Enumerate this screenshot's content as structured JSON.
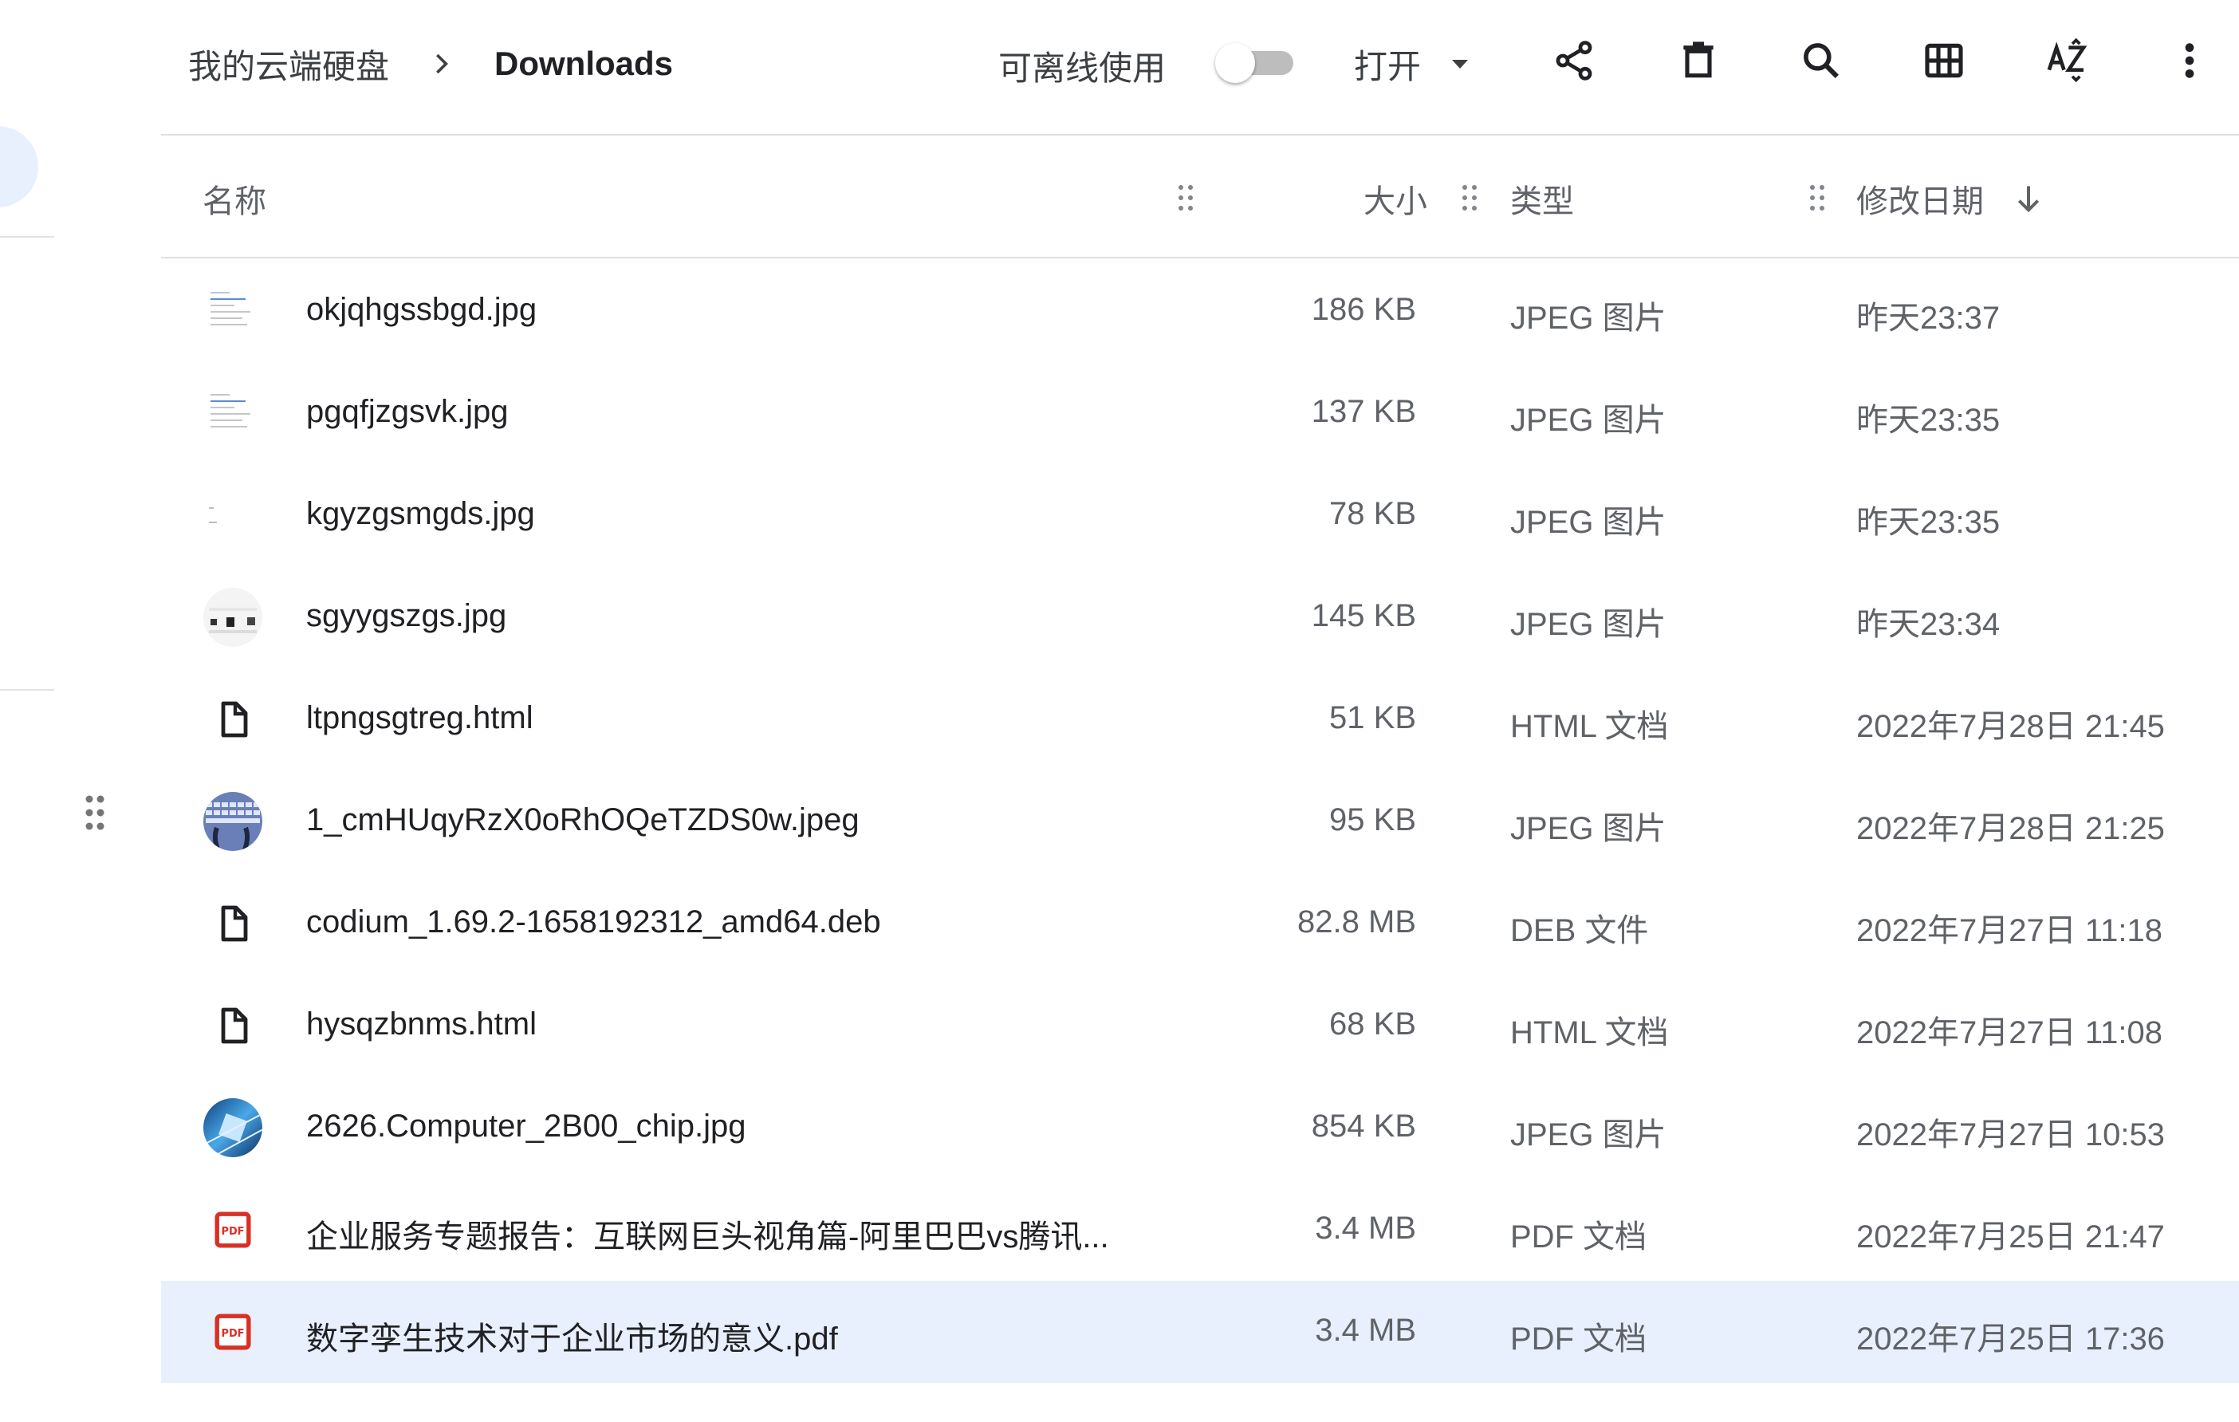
{
  "breadcrumb": {
    "root": "我的云端硬盘",
    "current": "Downloads"
  },
  "toolbar": {
    "offline_label": "可离线使用",
    "offline_enabled": false,
    "open_label": "打开",
    "icons": [
      "share-icon",
      "delete-icon",
      "search-icon",
      "grid-view-icon",
      "sort-az-icon",
      "more-vert-icon"
    ]
  },
  "columns": {
    "name": "名称",
    "size": "大小",
    "type": "类型",
    "modified": "修改日期"
  },
  "files": [
    {
      "name": "okjqhgssbgd.jpg",
      "size": "186 KB",
      "type": "JPEG 图片",
      "modified": "昨天23:37",
      "icon": "thumb-doc"
    },
    {
      "name": "pgqfjzgsvk.jpg",
      "size": "137 KB",
      "type": "JPEG 图片",
      "modified": "昨天23:35",
      "icon": "thumb-doc"
    },
    {
      "name": "kgyzgsmgds.jpg",
      "size": "78 KB",
      "type": "JPEG 图片",
      "modified": "昨天23:35",
      "icon": "thumb-blank"
    },
    {
      "name": "sgyygszgs.jpg",
      "size": "145 KB",
      "type": "JPEG 图片",
      "modified": "昨天23:34",
      "icon": "thumb-ui"
    },
    {
      "name": "ltpngsgtreg.html",
      "size": "51 KB",
      "type": "HTML 文档",
      "modified": "2022年7月28日 21:45",
      "icon": "file-icon"
    },
    {
      "name": "1_cmHUqyRzX0oRhOQeTZDS0w.jpeg",
      "size": "95 KB",
      "type": "JPEG 图片",
      "modified": "2022年7月28日 21:25",
      "icon": "thumb-keyboard"
    },
    {
      "name": "codium_1.69.2-1658192312_amd64.deb",
      "size": "82.8 MB",
      "type": "DEB 文件",
      "modified": "2022年7月27日 11:18",
      "icon": "file-icon"
    },
    {
      "name": "hysqzbnms.html",
      "size": "68 KB",
      "type": "HTML 文档",
      "modified": "2022年7月27日 11:08",
      "icon": "file-icon"
    },
    {
      "name": "2626.Computer_2B00_chip.jpg",
      "size": "854 KB",
      "type": "JPEG 图片",
      "modified": "2022年7月27日 10:53",
      "icon": "thumb-chip"
    },
    {
      "name": "企业服务专题报告：互联网巨头视角篇-阿里巴巴vs腾讯...",
      "size": "3.4 MB",
      "type": "PDF 文档",
      "modified": "2022年7月25日 21:47",
      "icon": "pdf-icon"
    },
    {
      "name": "数字孪生技术对于企业市场的意义.pdf",
      "size": "3.4 MB",
      "type": "PDF 文档",
      "modified": "2022年7月25日 17:36",
      "icon": "pdf-icon",
      "selected": true
    }
  ],
  "colors": {
    "selected_row": "#e8f0fe",
    "pdf_red": "#d93025",
    "icon": "#202124"
  }
}
